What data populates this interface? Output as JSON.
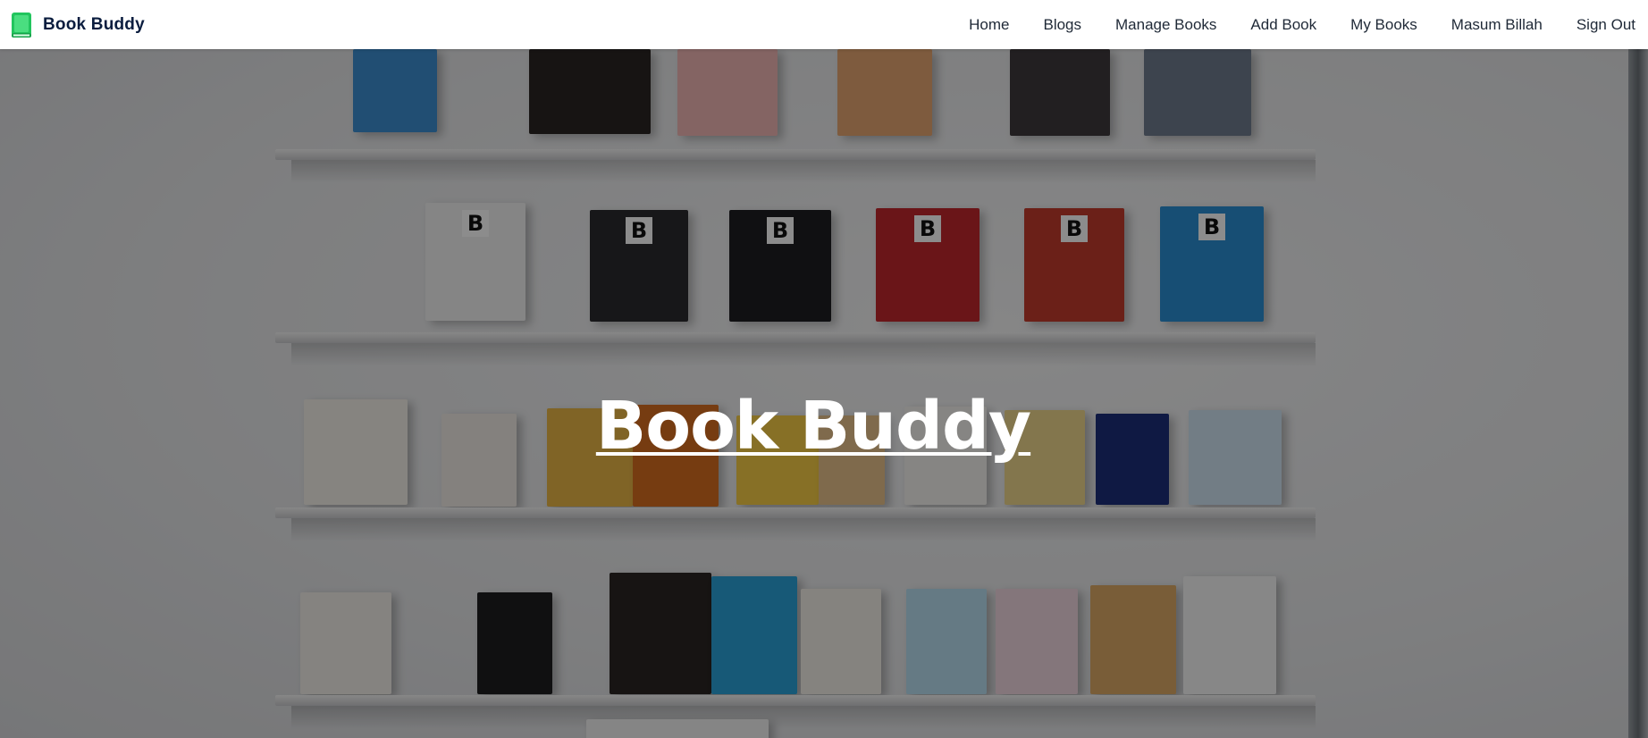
{
  "navbar": {
    "brand": "Book Buddy",
    "brand_icon": "book-icon",
    "brand_icon_color": "#22c55e",
    "links": [
      "Home",
      "Blogs",
      "Manage Books",
      "Add Book",
      "My Books",
      "Masum Billah",
      "Sign Out"
    ]
  },
  "hero": {
    "title": "Book Buddy",
    "background": "bookshelf photo with dark overlay"
  },
  "colors": {
    "brand_text": "#0b1d3f",
    "nav_text": "#1f2937",
    "hero_text": "#ffffff",
    "overlay": "rgba(0,0,0,0.45)"
  }
}
